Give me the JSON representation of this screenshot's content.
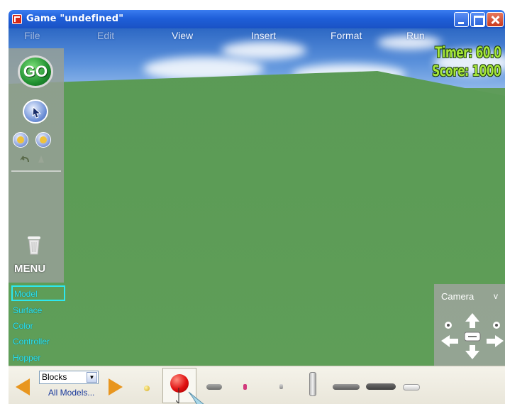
{
  "window": {
    "title": "Game \"undefined\"",
    "controls": {
      "minimize": "minimize",
      "maximize": "maximize",
      "close": "close"
    }
  },
  "menubar": {
    "items": [
      {
        "label": "File",
        "faded": true
      },
      {
        "label": "Edit",
        "faded": true
      },
      {
        "label": "View",
        "faded": false
      },
      {
        "label": "Insert",
        "faded": false
      },
      {
        "label": "Format",
        "faded": false
      },
      {
        "label": "Run",
        "faded": false
      }
    ]
  },
  "hud": {
    "timer": "Timer: 60.0",
    "score": "Score: 1000"
  },
  "left_panel": {
    "go_label": "GO",
    "menu_label": "MENU",
    "icons": [
      "select-arrow-icon",
      "rotate-icon",
      "add-icon",
      "undo-icon",
      "redo-icon",
      "trash-icon"
    ]
  },
  "categories": {
    "model": "Model",
    "surface": "Surface",
    "color": "Color",
    "controller": "Controller",
    "hopper": "Hopper"
  },
  "camera": {
    "label": "Camera",
    "dropdown": "v"
  },
  "toolbar": {
    "category_select_value": "Blocks",
    "all_models_link": "All Models..."
  },
  "colors": {
    "ground": "#5f9c5a",
    "sky": "#2d68c4",
    "hud_text": "#a6e63a",
    "category_text": "#2de8f0",
    "arrow_button": "#e8961f",
    "titlebar": "#1f5fd9"
  }
}
